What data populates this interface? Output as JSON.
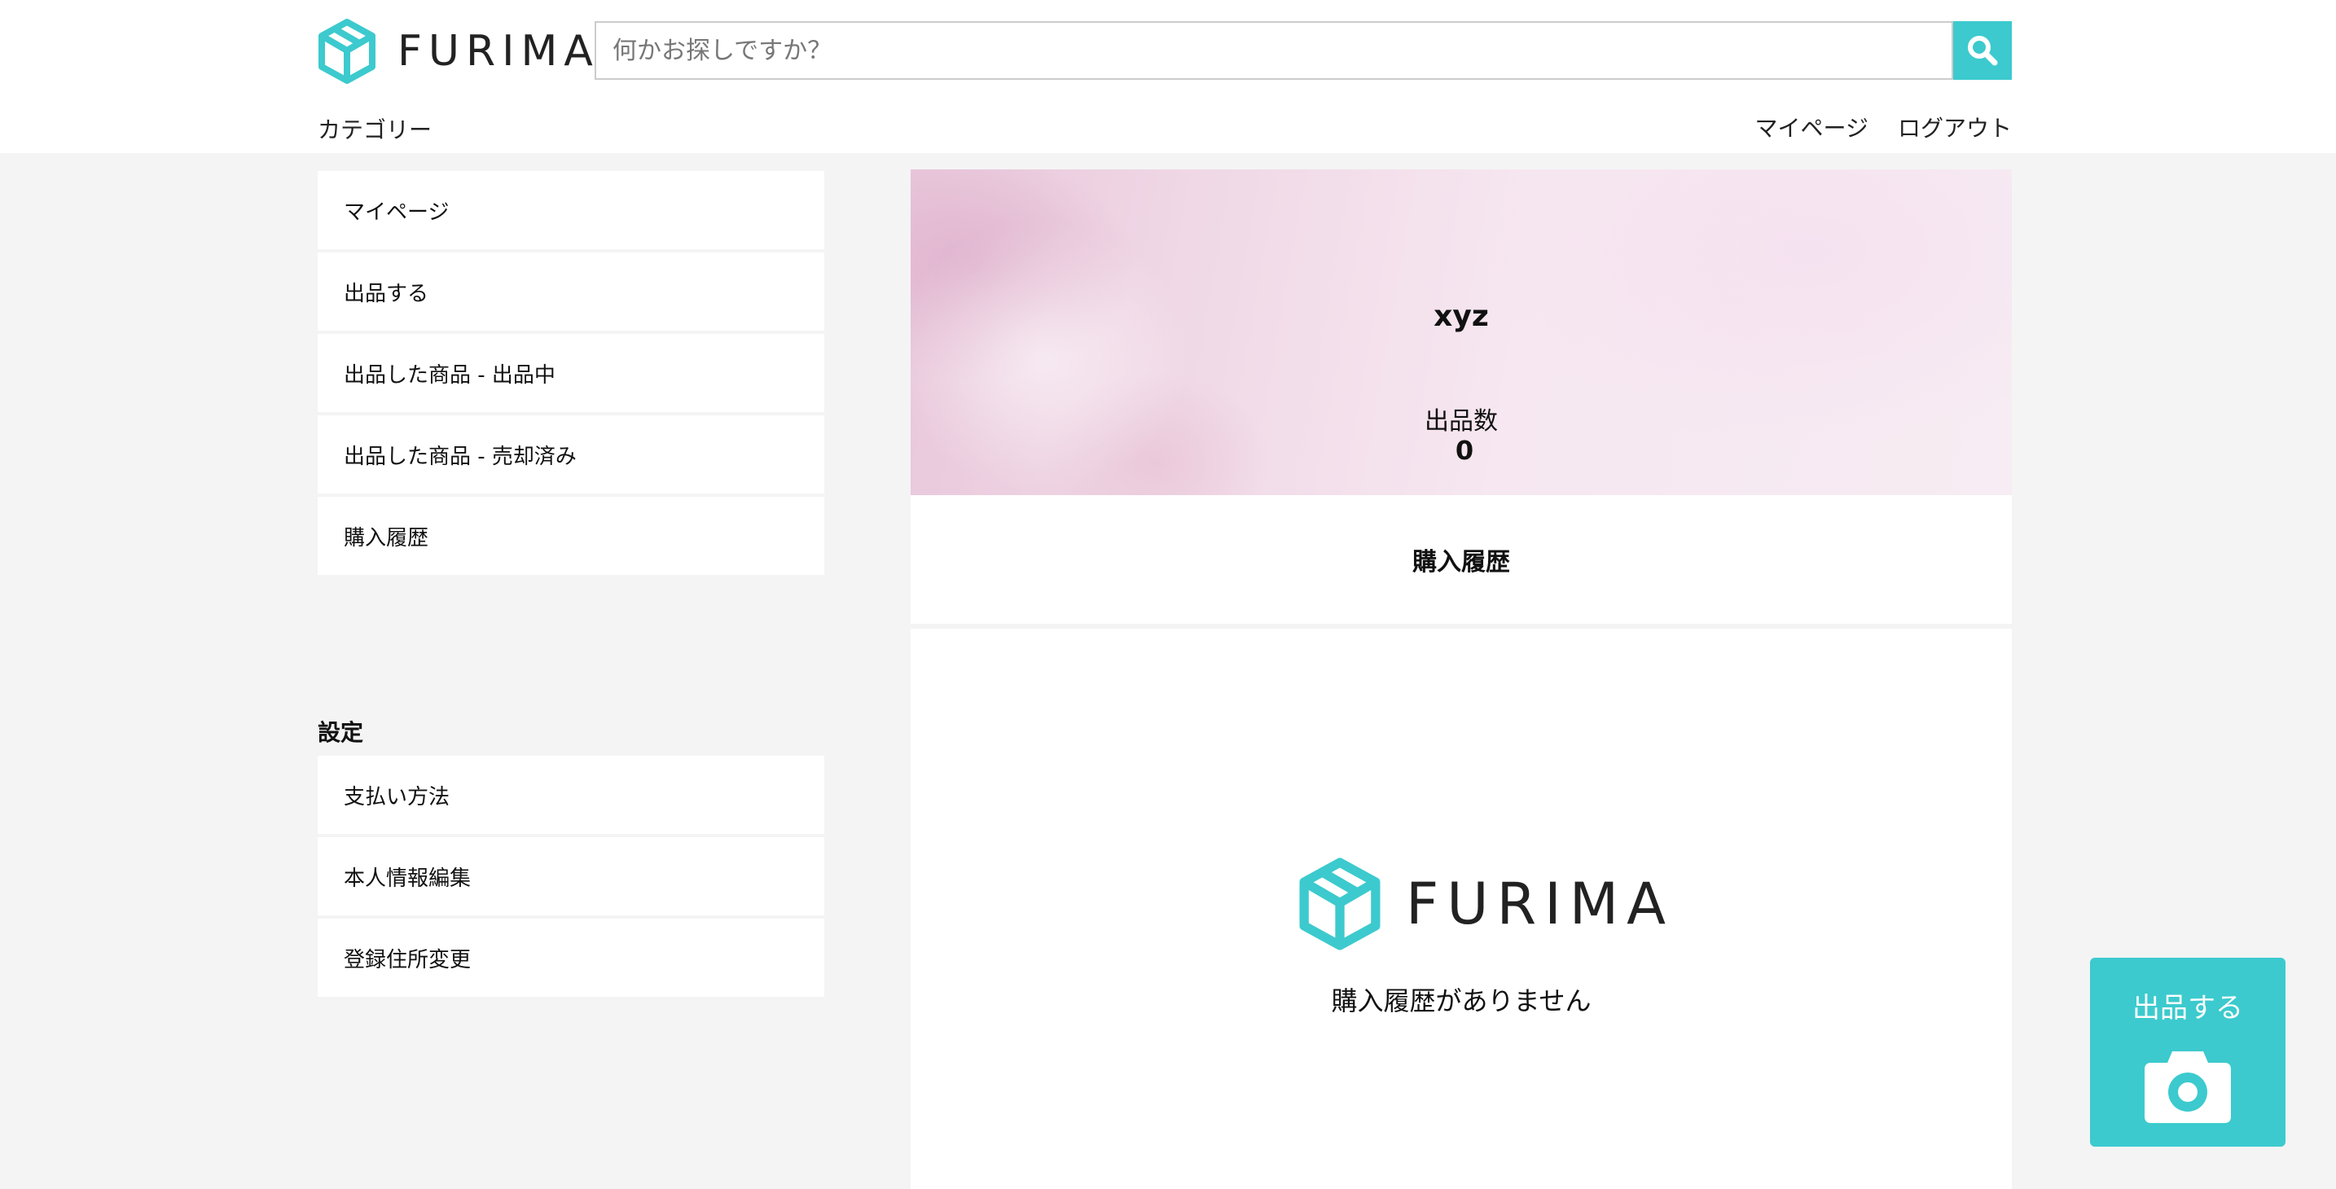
{
  "header": {
    "logo_text": "FURIMA",
    "search_placeholder": "何かお探しですか？",
    "category_label": "カテゴリー",
    "mypage_label": "マイページ",
    "logout_label": "ログアウト"
  },
  "sidebar": {
    "menu": [
      {
        "label": "マイページ"
      },
      {
        "label": "出品する"
      },
      {
        "label": "出品した商品 - 出品中"
      },
      {
        "label": "出品した商品 - 売却済み"
      },
      {
        "label": "購入履歴"
      }
    ],
    "settings_heading": "設定",
    "settings": [
      {
        "label": "支払い方法"
      },
      {
        "label": "本人情報編集"
      },
      {
        "label": "登録住所変更"
      }
    ]
  },
  "profile": {
    "username": "xyz",
    "listing_count_label": "出品数",
    "listing_count": "0"
  },
  "main": {
    "section_title": "購入履歴",
    "empty_logo_text": "FURIMA",
    "empty_message": "購入履歴がありません"
  },
  "sell_button": {
    "label": "出品する"
  },
  "colors": {
    "accent": "#3ccace",
    "background": "#f4f4f4",
    "logo_text": "#222222"
  },
  "icons": [
    "box-logo-icon",
    "search-icon",
    "camera-icon"
  ]
}
